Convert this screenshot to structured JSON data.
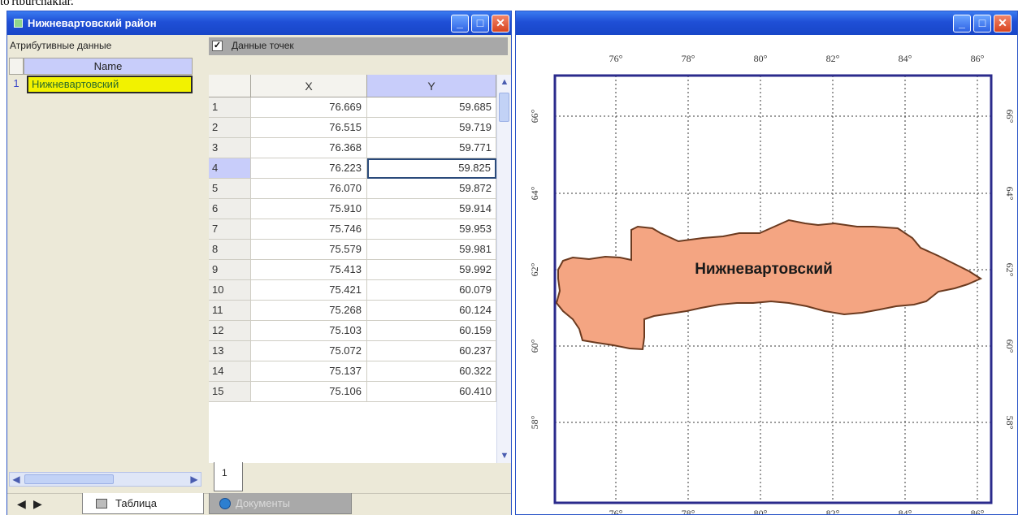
{
  "page_top_text": "to'rtburchaklar.",
  "left_window": {
    "title": "Нижневартовский район",
    "buttons": {
      "minimize": "_",
      "maximize": "□",
      "close": "✕"
    },
    "attr_label": "Атрибутивные данные",
    "points_checkbox": {
      "checked": true,
      "mark": "✓",
      "label": "Данные точек"
    },
    "attributes": {
      "header": "Name",
      "rows": [
        {
          "num": "1",
          "value": "Нижневартовский"
        }
      ]
    },
    "points": {
      "headers": {
        "x": "X",
        "y": "Y"
      },
      "selected_row": 3,
      "rows": [
        {
          "n": "1",
          "x": "76.669",
          "y": "59.685"
        },
        {
          "n": "2",
          "x": "76.515",
          "y": "59.719"
        },
        {
          "n": "3",
          "x": "76.368",
          "y": "59.771"
        },
        {
          "n": "4",
          "x": "76.223",
          "y": "59.825"
        },
        {
          "n": "5",
          "x": "76.070",
          "y": "59.872"
        },
        {
          "n": "6",
          "x": "75.910",
          "y": "59.914"
        },
        {
          "n": "7",
          "x": "75.746",
          "y": "59.953"
        },
        {
          "n": "8",
          "x": "75.579",
          "y": "59.981"
        },
        {
          "n": "9",
          "x": "75.413",
          "y": "59.992"
        },
        {
          "n": "10",
          "x": "75.421",
          "y": "60.079"
        },
        {
          "n": "11",
          "x": "75.268",
          "y": "60.124"
        },
        {
          "n": "12",
          "x": "75.103",
          "y": "60.159"
        },
        {
          "n": "13",
          "x": "75.072",
          "y": "60.237"
        },
        {
          "n": "14",
          "x": "75.137",
          "y": "60.322"
        },
        {
          "n": "15",
          "x": "75.106",
          "y": "60.410"
        }
      ]
    },
    "page_tab": "1",
    "bottom_tabs": {
      "table": "Таблица",
      "documents": "Документы"
    },
    "nav": {
      "prev": "◀",
      "next": "▶"
    }
  },
  "map_window": {
    "buttons": {
      "minimize": "_",
      "maximize": "□",
      "close": "✕"
    },
    "lon_labels": [
      "76°",
      "78°",
      "80°",
      "82°",
      "84°",
      "86°"
    ],
    "lat_labels": [
      "66°",
      "64°",
      "62°",
      "60°",
      "58°"
    ],
    "region_label": "Нижневартовский",
    "colors": {
      "region_fill": "#f4a582",
      "region_stroke": "#6b3a1f",
      "frame": "#2b2b8c",
      "grid": "#3a3a3a"
    }
  }
}
